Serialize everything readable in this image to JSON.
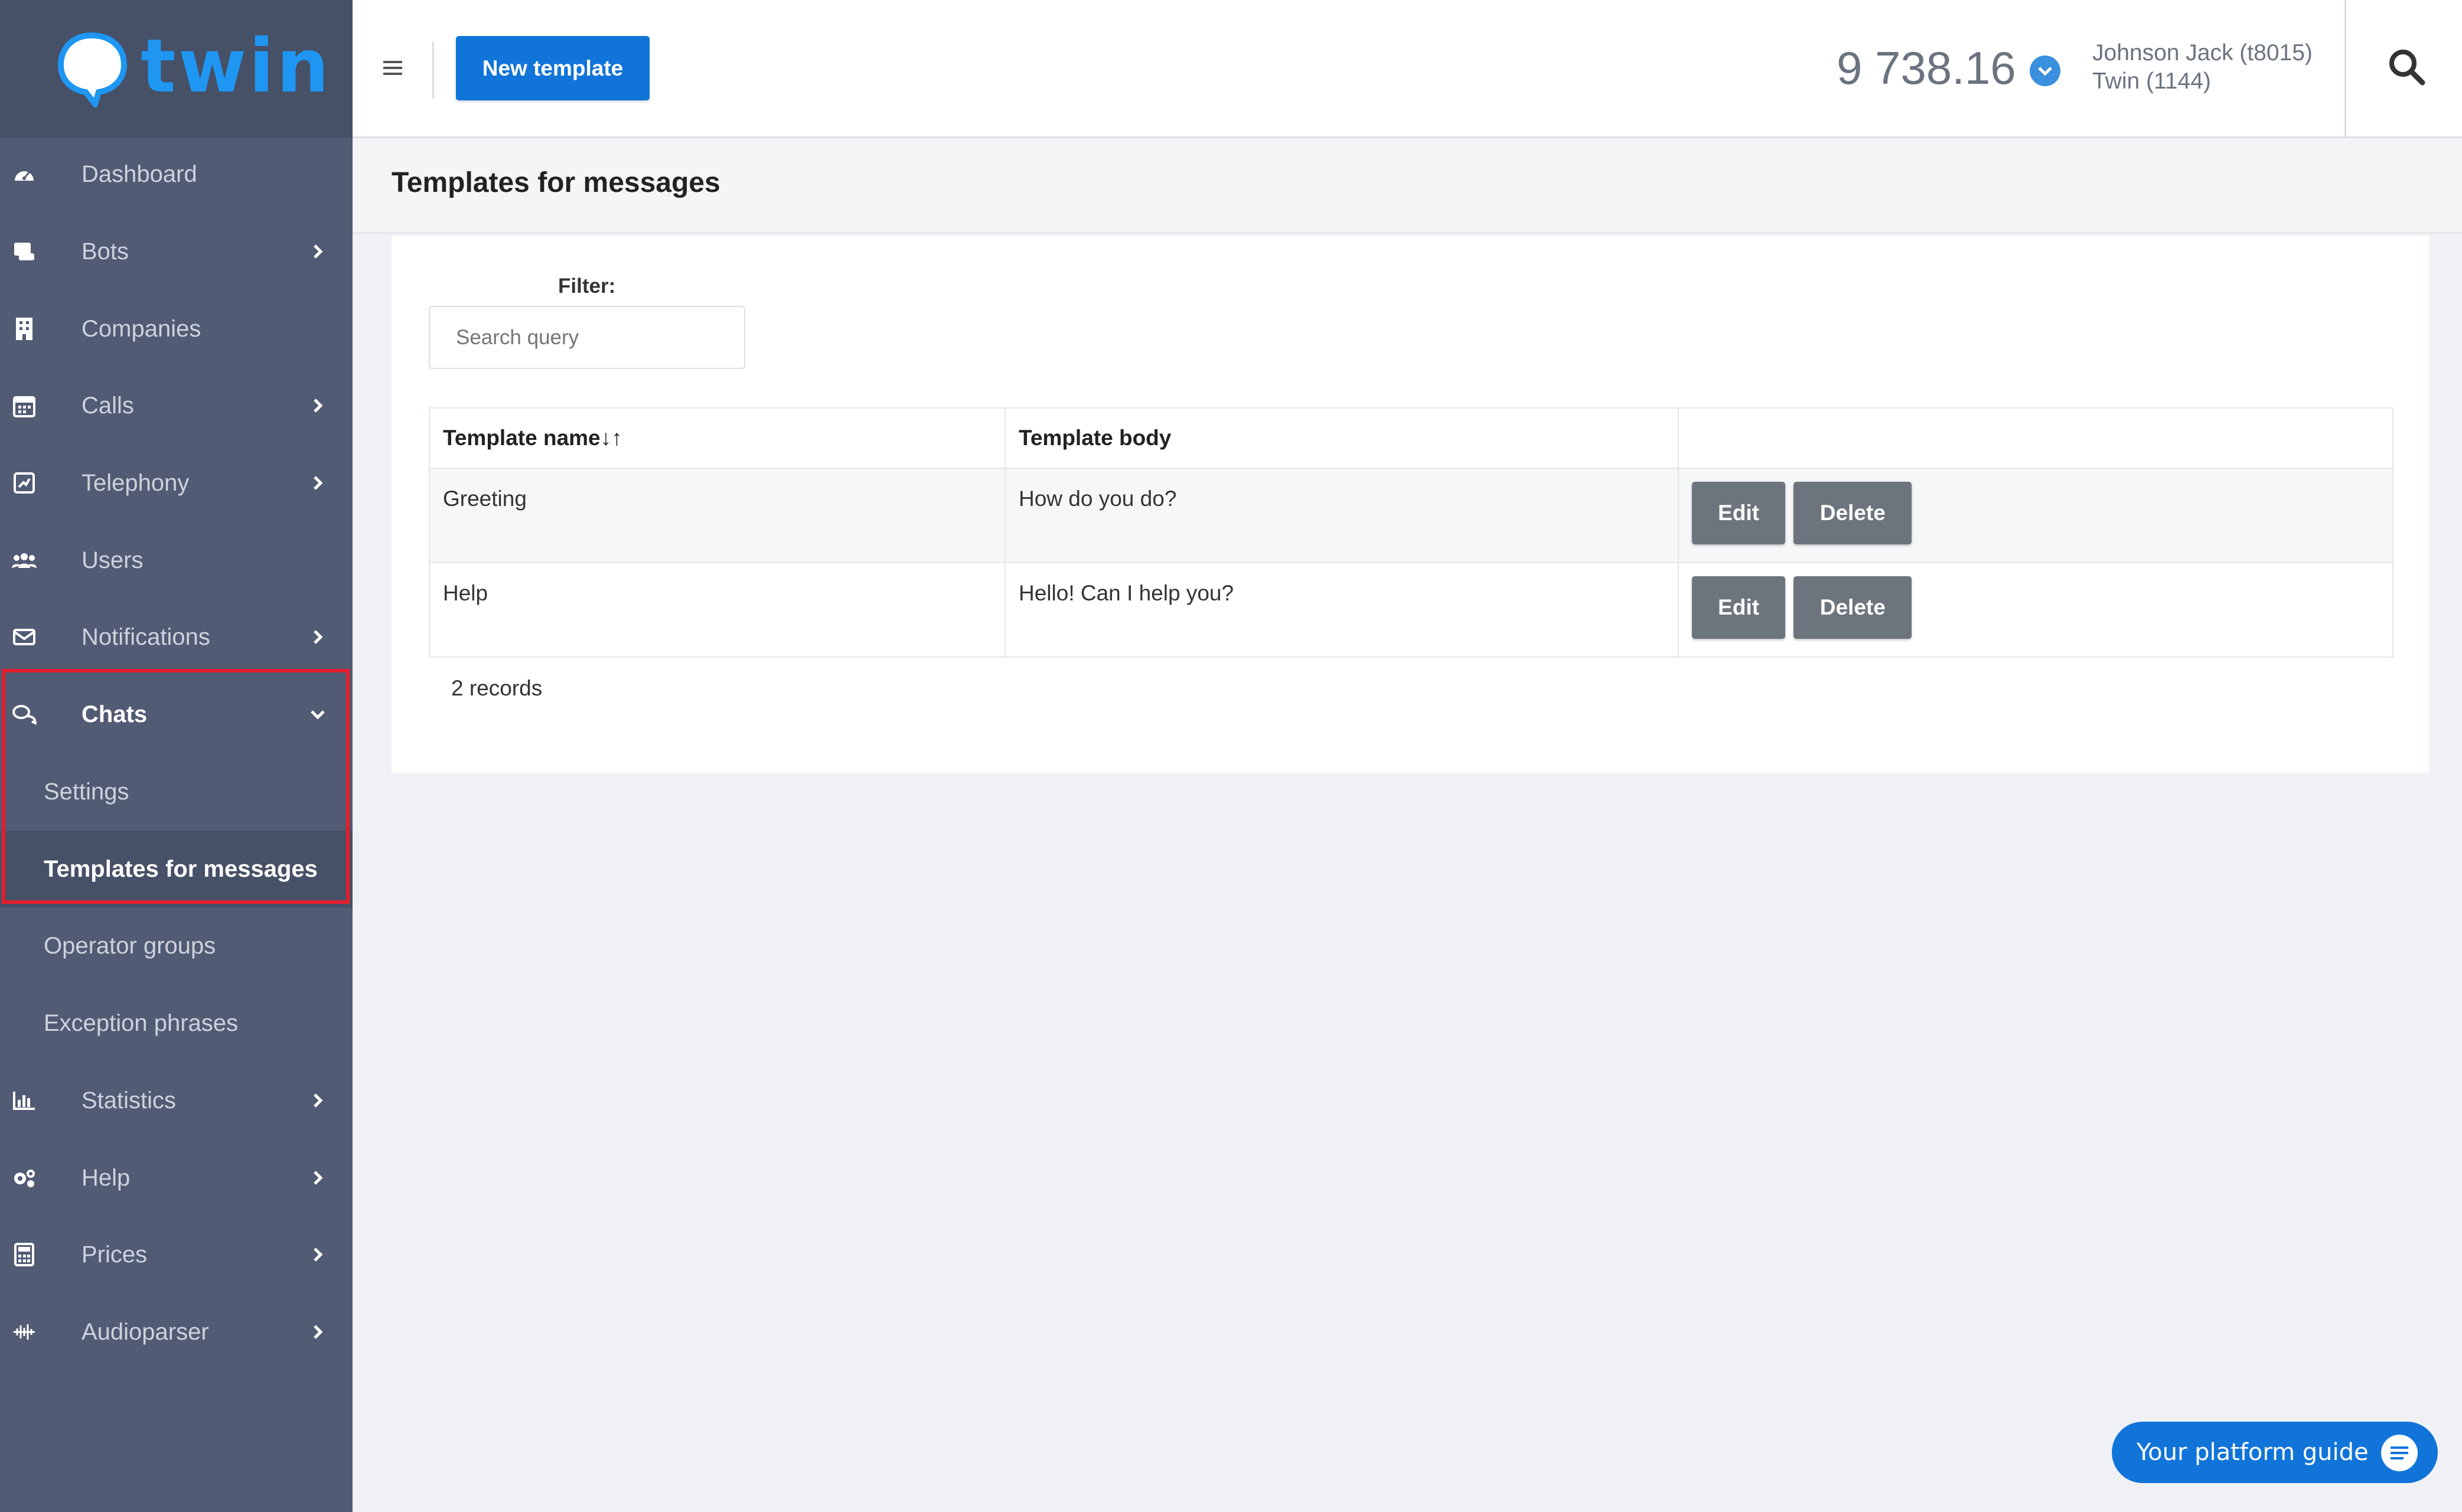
{
  "logo": {
    "text": "twin"
  },
  "sidebar": {
    "items": [
      {
        "label": "Dashboard",
        "icon": "dashboard-icon"
      },
      {
        "label": "Bots",
        "icon": "bot-icon"
      },
      {
        "label": "Companies",
        "icon": "building-icon"
      },
      {
        "label": "Calls",
        "icon": "calendar-icon"
      },
      {
        "label": "Telephony",
        "icon": "telephony-icon"
      },
      {
        "label": "Users",
        "icon": "users-icon"
      },
      {
        "label": "Notifications",
        "icon": "envelope-icon"
      },
      {
        "label": "Chats",
        "icon": "chats-icon"
      },
      {
        "label": "Statistics",
        "icon": "chart-icon"
      },
      {
        "label": "Help",
        "icon": "gears-icon"
      },
      {
        "label": "Prices",
        "icon": "calculator-icon"
      },
      {
        "label": "Audioparser",
        "icon": "waveform-icon"
      }
    ],
    "chats_sub": [
      {
        "label": "Settings"
      },
      {
        "label": "Templates for messages"
      },
      {
        "label": "Operator groups"
      },
      {
        "label": "Exception phrases"
      }
    ]
  },
  "topbar": {
    "new_template_label": "New template",
    "balance": "9 738.16",
    "user_line1": "Johnson Jack (t8015)",
    "user_line2": "Twin (1144)"
  },
  "page": {
    "title": "Templates for messages",
    "filter_label": "Filter:",
    "search_placeholder": "Search query",
    "table": {
      "headers": [
        "Template name",
        "Template body",
        ""
      ],
      "rows": [
        {
          "name": "Greeting",
          "body": "How do you do?",
          "edit": "Edit",
          "delete": "Delete"
        },
        {
          "name": "Help",
          "body": "Hello! Can I help you?",
          "edit": "Edit",
          "delete": "Delete"
        }
      ]
    },
    "records": "2 records"
  },
  "guide": {
    "label": "Your platform guide"
  },
  "colors": {
    "accent": "#1174d9",
    "sidebar": "#515b73",
    "highlight": "#e31e2d"
  }
}
